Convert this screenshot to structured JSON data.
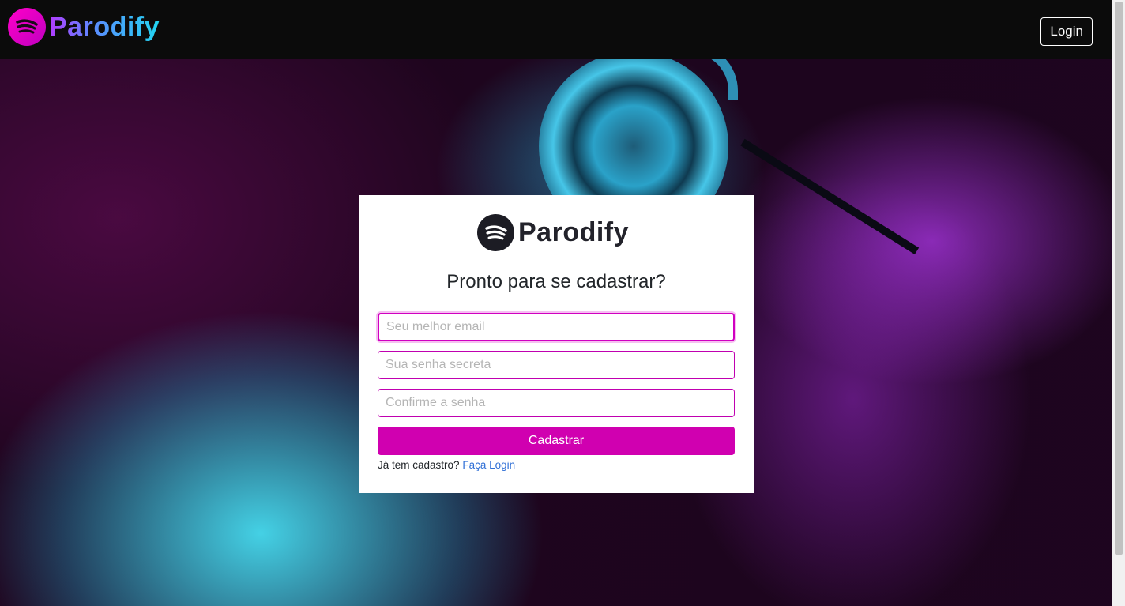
{
  "navbar": {
    "brand_name": "Parodify",
    "login_label": "Login"
  },
  "card": {
    "brand_name": "Parodify",
    "title": "Pronto para se cadastrar?",
    "email_placeholder": "Seu melhor email",
    "password_placeholder": "Sua senha secreta",
    "confirm_placeholder": "Confirme a senha",
    "submit_label": "Cadastrar",
    "footer_text": "Já tem cadastro?",
    "footer_link": "Faça Login"
  },
  "colors": {
    "accent": "#d000b0",
    "link": "#2f6fd6",
    "navbar_bg": "#0b0b0b"
  },
  "icons": {
    "brand_logo": "sound-waves-icon"
  }
}
